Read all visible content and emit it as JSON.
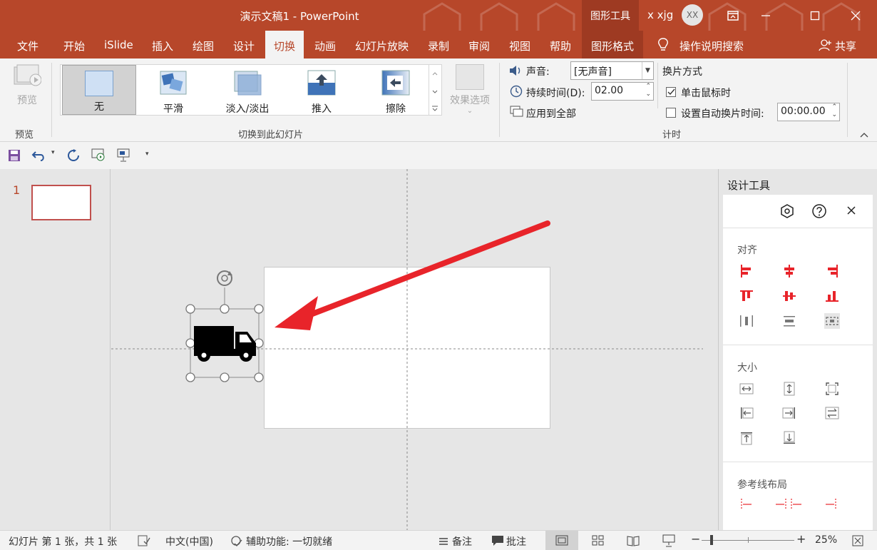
{
  "titlebar": {
    "title": "演示文稿1  -  PowerPoint",
    "context_tab": "图形工具",
    "user_name": "x xjg",
    "avatar_initials": "XX"
  },
  "tabs": [
    "文件",
    "开始",
    "iSlide",
    "插入",
    "绘图",
    "设计",
    "切换",
    "动画",
    "幻灯片放映",
    "录制",
    "审阅",
    "视图",
    "帮助",
    "图形格式"
  ],
  "tell_me": "操作说明搜索",
  "share": "共享",
  "ribbon": {
    "preview_label": "预览",
    "preview_group": "预览",
    "transitions": [
      "无",
      "平滑",
      "淡入/淡出",
      "推入",
      "擦除"
    ],
    "transitions_group": "切换到此幻灯片",
    "effect_options": "效果选项",
    "sound_label": "声音:",
    "sound_value": "[无声音]",
    "duration_label": "持续时间(D):",
    "duration_value": "02.00",
    "apply_all": "应用到全部",
    "advance_title": "换片方式",
    "on_click": "单击鼠标时",
    "after_time": "设置自动换片时间:",
    "after_value": "00:00.00",
    "timing_group": "计时"
  },
  "thumbs": {
    "number": "1"
  },
  "pane": {
    "title": "设计工具",
    "align_section": "对齐",
    "size_section": "大小",
    "guide_section": "参考线布局"
  },
  "status": {
    "slide_info": "幻灯片 第 1 张，共 1 张",
    "language": "中文(中国)",
    "accessibility": "辅助功能: 一切就绪",
    "notes": "备注",
    "comments": "批注",
    "zoom": "25%"
  },
  "colors": {
    "brand": "#b7472a",
    "accent_red": "#e8242a"
  }
}
